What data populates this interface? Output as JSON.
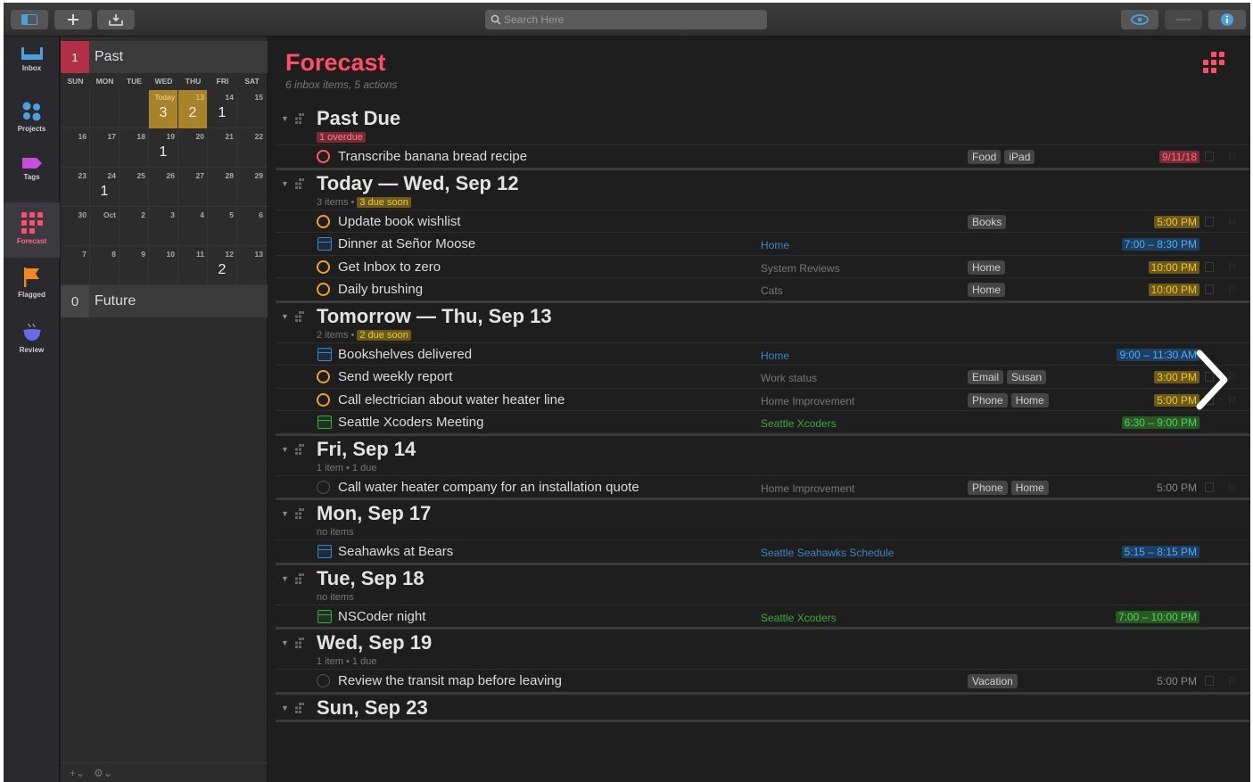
{
  "search": {
    "placeholder": "Search Here"
  },
  "sidebar": [
    {
      "label": "Inbox",
      "icon": "inbox-icon"
    },
    {
      "label": "Projects",
      "icon": "projects-icon"
    },
    {
      "label": "Tags",
      "icon": "tags-icon"
    },
    {
      "label": "Forecast",
      "icon": "forecast-icon"
    },
    {
      "label": "Flagged",
      "icon": "flag-icon"
    },
    {
      "label": "Review",
      "icon": "review-icon"
    }
  ],
  "calendar": {
    "past": {
      "count": "1",
      "label": "Past"
    },
    "future": {
      "count": "0",
      "label": "Future"
    },
    "dow": [
      "SUN",
      "MON",
      "TUE",
      "WED",
      "THU",
      "FRI",
      "SAT"
    ],
    "weeks": [
      [
        {
          "d": ""
        },
        {
          "d": ""
        },
        {
          "d": ""
        },
        {
          "d": "Today",
          "c": "3",
          "today": true
        },
        {
          "d": "13",
          "c": "2",
          "today": true
        },
        {
          "d": "14",
          "c": "1"
        },
        {
          "d": "15"
        }
      ],
      [
        {
          "d": "16"
        },
        {
          "d": "17"
        },
        {
          "d": "18"
        },
        {
          "d": "19",
          "c": "1"
        },
        {
          "d": "20"
        },
        {
          "d": "21"
        },
        {
          "d": "22"
        }
      ],
      [
        {
          "d": "23"
        },
        {
          "d": "24",
          "c": "1"
        },
        {
          "d": "25"
        },
        {
          "d": "26"
        },
        {
          "d": "27"
        },
        {
          "d": "28"
        },
        {
          "d": "29"
        }
      ],
      [
        {
          "d": "30"
        },
        {
          "d": "Oct"
        },
        {
          "d": "2"
        },
        {
          "d": "3"
        },
        {
          "d": "4"
        },
        {
          "d": "5"
        },
        {
          "d": "6"
        }
      ],
      [
        {
          "d": "7"
        },
        {
          "d": "8"
        },
        {
          "d": "9"
        },
        {
          "d": "10"
        },
        {
          "d": "11"
        },
        {
          "d": "12",
          "c": "2"
        },
        {
          "d": "13"
        }
      ]
    ]
  },
  "main": {
    "title": "Forecast",
    "subtitle": "6 inbox items, 5 actions",
    "sections": [
      {
        "title": "Past Due",
        "meta": "",
        "badge": "1 overdue",
        "badgeColor": "red",
        "rows": [
          {
            "kind": "task",
            "chk": "red",
            "name": "Transcribe banana bread recipe",
            "ctx": "",
            "ctxColor": "",
            "tags": [
              "Food",
              "iPad"
            ],
            "due": "9/11/18",
            "dueColor": "red"
          }
        ]
      },
      {
        "title": "Today — Wed, Sep 12",
        "meta": "3 items •",
        "badge": "3 due soon",
        "badgeColor": "yellow",
        "rows": [
          {
            "kind": "task",
            "chk": "yellow",
            "name": "Update book wishlist",
            "ctx": "",
            "ctxColor": "",
            "tags": [
              "Books"
            ],
            "due": "5:00 PM",
            "dueColor": "yellow"
          },
          {
            "kind": "event",
            "cal": "blue",
            "name": "Dinner at Señor Moose",
            "ctx": "Home",
            "ctxColor": "blue",
            "tags": [],
            "due": "7:00 – 8:30 PM",
            "dueColor": "blue"
          },
          {
            "kind": "task",
            "chk": "yellow",
            "name": "Get Inbox to zero",
            "ctx": "System Reviews",
            "ctxColor": "",
            "tags": [
              "Home"
            ],
            "due": "10:00 PM",
            "dueColor": "yellow"
          },
          {
            "kind": "task",
            "chk": "yellow",
            "name": "Daily brushing",
            "ctx": "Cats",
            "ctxColor": "",
            "tags": [
              "Home"
            ],
            "due": "10:00 PM",
            "dueColor": "yellow"
          }
        ]
      },
      {
        "title": "Tomorrow — Thu, Sep 13",
        "meta": "2 items •",
        "badge": "2 due soon",
        "badgeColor": "yellow",
        "rows": [
          {
            "kind": "event",
            "cal": "blue",
            "name": "Bookshelves delivered",
            "ctx": "Home",
            "ctxColor": "blue",
            "tags": [],
            "due": "9:00 – 11:30 AM",
            "dueColor": "blue"
          },
          {
            "kind": "task",
            "chk": "yellow",
            "name": "Send weekly report",
            "ctx": "Work status",
            "ctxColor": "",
            "tags": [
              "Email",
              "Susan"
            ],
            "due": "3:00 PM",
            "dueColor": "yellow"
          },
          {
            "kind": "task",
            "chk": "yellow",
            "name": "Call electrician about water heater line",
            "ctx": "Home Improvement",
            "ctxColor": "",
            "tags": [
              "Phone",
              "Home"
            ],
            "due": "5:00 PM",
            "dueColor": "yellow"
          },
          {
            "kind": "event",
            "cal": "green",
            "name": "Seattle Xcoders Meeting",
            "ctx": "Seattle Xcoders",
            "ctxColor": "green",
            "tags": [],
            "due": "6:30 – 9:00 PM",
            "dueColor": "green"
          }
        ]
      },
      {
        "title": "Fri, Sep 14",
        "meta": "1 item • 1 due",
        "badge": "",
        "badgeColor": "",
        "rows": [
          {
            "kind": "task",
            "chk": "dim",
            "name": "Call water heater company for an installation quote",
            "ctx": "Home Improvement",
            "ctxColor": "",
            "tags": [
              "Phone",
              "Home"
            ],
            "due": "5:00 PM",
            "dueColor": "plain"
          }
        ]
      },
      {
        "title": "Mon, Sep 17",
        "meta": "no items",
        "badge": "",
        "badgeColor": "",
        "rows": [
          {
            "kind": "event",
            "cal": "blue",
            "name": "Seahawks at Bears",
            "ctx": "Seattle Seahawks Schedule",
            "ctxColor": "blue",
            "tags": [],
            "due": "5:15 – 8:15 PM",
            "dueColor": "blue"
          }
        ]
      },
      {
        "title": "Tue, Sep 18",
        "meta": "no items",
        "badge": "",
        "badgeColor": "",
        "rows": [
          {
            "kind": "event",
            "cal": "green",
            "name": "NSCoder night",
            "ctx": "Seattle Xcoders",
            "ctxColor": "green",
            "tags": [],
            "due": "7:00 – 10:00 PM",
            "dueColor": "green"
          }
        ]
      },
      {
        "title": "Wed, Sep 19",
        "meta": "1 item • 1 due",
        "badge": "",
        "badgeColor": "",
        "rows": [
          {
            "kind": "task",
            "chk": "dim",
            "name": "Review the transit map before leaving",
            "ctx": "",
            "ctxColor": "",
            "tags": [
              "Vacation"
            ],
            "due": "5:00 PM",
            "dueColor": "plain"
          }
        ]
      },
      {
        "title": "Sun, Sep 23",
        "meta": "",
        "badge": "",
        "badgeColor": "",
        "rows": []
      }
    ]
  },
  "colors": {
    "accent": "#ff4d6a",
    "today": "#a8832a",
    "background": "#1e1e1e"
  }
}
